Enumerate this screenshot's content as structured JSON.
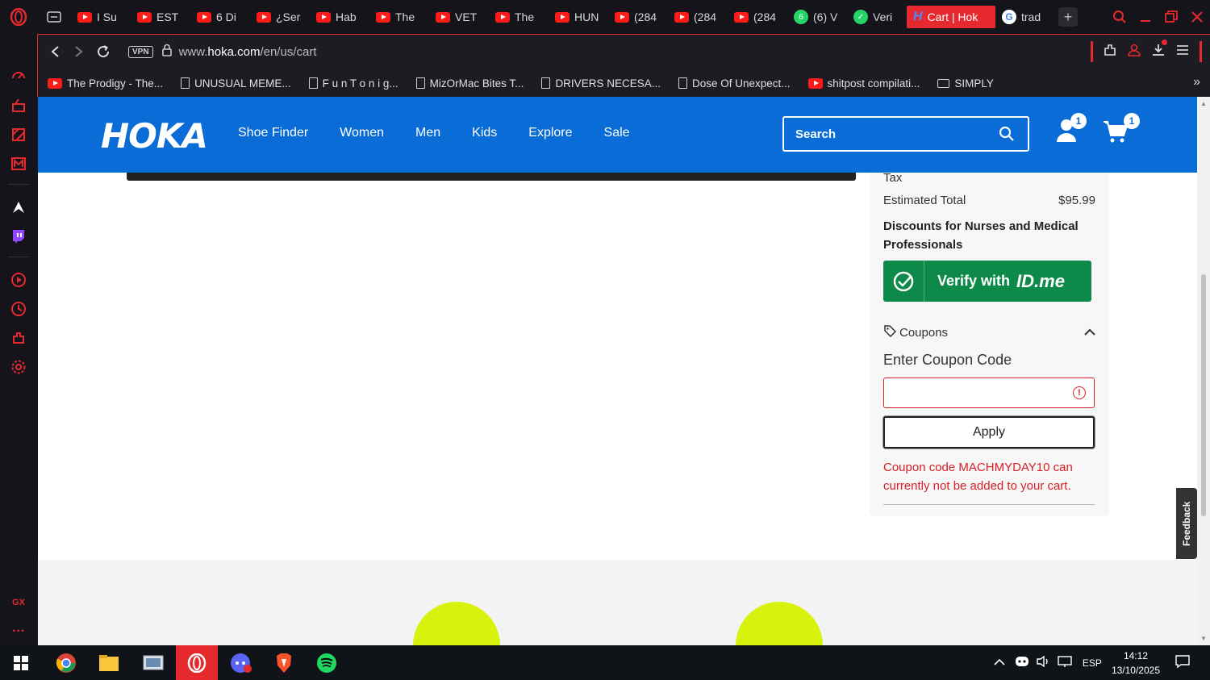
{
  "browser": {
    "tabs": [
      {
        "label": "I Su",
        "icon": "youtube-icon"
      },
      {
        "label": "EST",
        "icon": "youtube-icon"
      },
      {
        "label": "6 Di",
        "icon": "youtube-icon"
      },
      {
        "label": "¿Ser",
        "icon": "youtube-icon"
      },
      {
        "label": "Hab",
        "icon": "youtube-icon"
      },
      {
        "label": "The",
        "icon": "youtube-icon"
      },
      {
        "label": "VET",
        "icon": "youtube-icon"
      },
      {
        "label": "The",
        "icon": "youtube-icon"
      },
      {
        "label": "HUN",
        "icon": "youtube-icon"
      },
      {
        "label": "(284",
        "icon": "youtube-icon"
      },
      {
        "label": "(284",
        "icon": "youtube-icon"
      },
      {
        "label": "(284",
        "icon": "youtube-icon"
      },
      {
        "label": "(6) V",
        "icon": "whatsapp-icon",
        "badge": "6"
      },
      {
        "label": "Veri",
        "icon": "verify-icon"
      },
      {
        "label": "Cart | Hok",
        "icon": "hoka-icon",
        "active": true
      },
      {
        "label": "trad",
        "icon": "google-icon"
      }
    ],
    "url_prefix": "www.",
    "url_domain": "hoka.com",
    "url_path": "/en/us/cart",
    "vpn_label": "VPN",
    "bookmarks": [
      {
        "label": "The Prodigy - The...",
        "type": "youtube"
      },
      {
        "label": "UNUSUAL MEME...",
        "type": "page"
      },
      {
        "label": "F u n  T o n i g...",
        "type": "page"
      },
      {
        "label": "MizOrMac Bites T...",
        "type": "page"
      },
      {
        "label": "DRIVERS NECESA...",
        "type": "page"
      },
      {
        "label": "Dose Of Unexpect...",
        "type": "page"
      },
      {
        "label": "shitpost compilati...",
        "type": "youtube"
      },
      {
        "label": "SIMPLY",
        "type": "folder"
      }
    ],
    "sidebar_label_gx": "GX"
  },
  "hoka": {
    "logo": "HOKA",
    "nav": [
      "Shoe Finder",
      "Women",
      "Men",
      "Kids",
      "Explore",
      "Sale"
    ],
    "search_placeholder": "Search",
    "account_badge": "1",
    "cart_badge": "1",
    "summary": {
      "tax_label": "Tax",
      "estimated_total_label": "Estimated Total",
      "estimated_total_value": "$95.99",
      "discount_heading": "Discounts for Nurses and Medical Professionals",
      "verify_label": "Verify with",
      "verify_brand": "ID.me",
      "coupons_label": "Coupons",
      "enter_coupon_label": "Enter Coupon Code",
      "coupon_value": "",
      "apply_label": "Apply",
      "error_message": "Coupon code MACHMYDAY10 can currently not be added to your cart."
    },
    "feedback_label": "Feedback"
  },
  "taskbar": {
    "language": "ESP",
    "time": "14:12",
    "date": "13/10/2025"
  },
  "colors": {
    "hoka_blue": "#0a6cd6",
    "error_red": "#d61f26",
    "idme_green": "#0d8a4a",
    "opera_red": "#e5292f",
    "footer_circle": "#d7f20c"
  }
}
